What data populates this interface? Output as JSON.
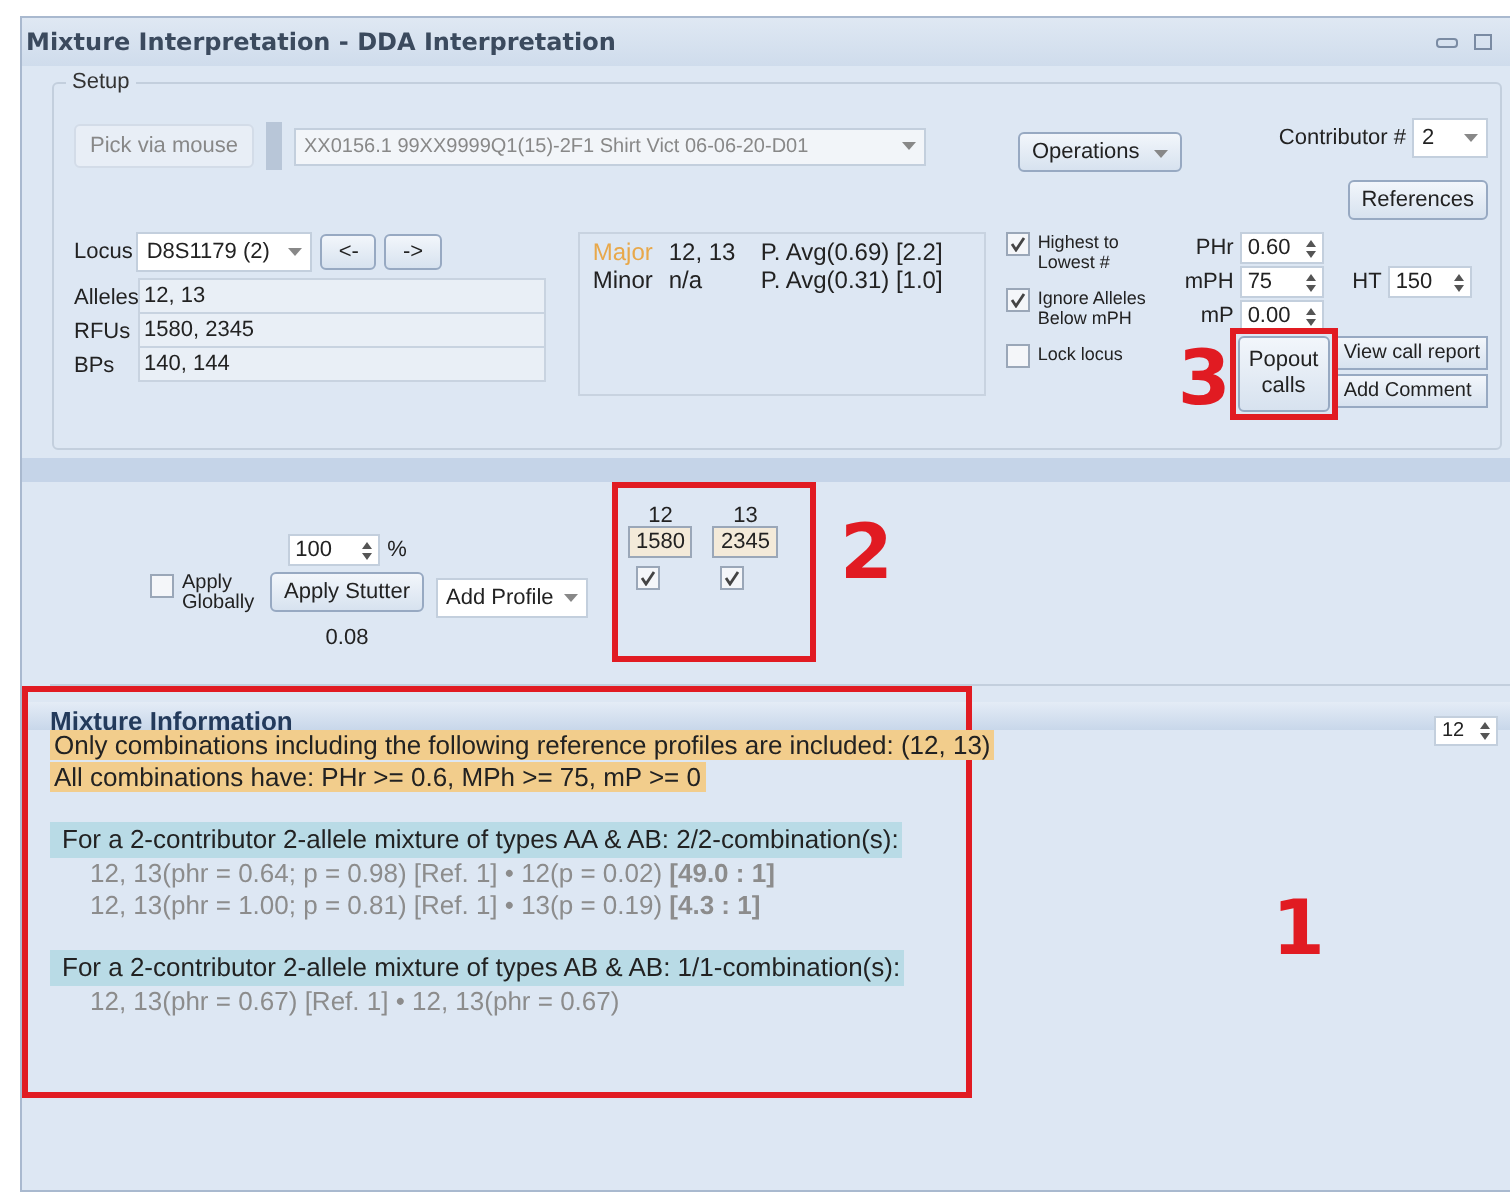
{
  "window": {
    "title": "Mixture Interpretation - DDA Interpretation"
  },
  "setup": {
    "label": "Setup",
    "pick_button": "Pick via mouse",
    "sample": "XX0156.1 99XX9999Q1(15)-2F1 Shirt Vict  06-06-20-D01",
    "operations_button": "Operations",
    "contributor": {
      "label": "Contributor #",
      "value": "2"
    },
    "references_button": "References",
    "locus": {
      "label": "Locus",
      "value": "D8S1179 (2)"
    },
    "prev_button": "<-",
    "next_button": "->",
    "fields": [
      {
        "label": "Alleles",
        "value": "12, 13"
      },
      {
        "label": "RFUs",
        "value": "1580, 2345"
      },
      {
        "label": "BPs",
        "value": "140, 144"
      }
    ],
    "calls": [
      {
        "label": "Major",
        "value": "12, 13",
        "average": "P. Avg(0.69) [2.2]",
        "highlighted": true
      },
      {
        "label": "Minor",
        "value": "n/a",
        "average": "P. Avg(0.31) [1.0]",
        "highlighted": false
      }
    ],
    "checks": [
      {
        "label": "Highest to Lowest #",
        "checked": true
      },
      {
        "label": "Ignore Alleles Below mPH",
        "checked": true
      },
      {
        "label": "Lock locus",
        "checked": false
      }
    ],
    "params": [
      {
        "label": "PHr",
        "value": "0.60"
      },
      {
        "label": "mPH",
        "value": "75"
      },
      {
        "label": "mP",
        "value": "0.00"
      }
    ],
    "ht": {
      "label": "HT",
      "value": "150"
    },
    "popout_button": "Popout calls",
    "popout_annotation": "3",
    "view_report_button": "View call report",
    "add_comment_button": "Add Comment"
  },
  "stutter": {
    "apply_globally": {
      "label": "Apply Globally",
      "checked": false
    },
    "percent": "100",
    "unit": "%",
    "apply_button": "Apply Stutter",
    "value": "0.08",
    "add_profile": "Add Profile",
    "alleles": [
      {
        "allele": "12",
        "rfu": "1580",
        "checked": true
      },
      {
        "allele": "13",
        "rfu": "2345",
        "checked": true
      }
    ],
    "alleles_annotation": "2"
  },
  "mixture": {
    "title": "Mixture Information",
    "spinner": "12",
    "annotation": "1",
    "notes": [
      "Only combinations including the following reference profiles are included: (12, 13)",
      "All combinations have:  PHr >= 0.6, MPh >= 75, mP >= 0"
    ],
    "groups": [
      {
        "heading": "For a 2-contributor 2-allele mixture of types AA & AB: 2/2-combination(s):",
        "lines": [
          "12, 13(phr = 0.64; p = 0.98) [Ref. 1] • 12(p = 0.02)  **[49.0 : 1]**",
          "12, 13(phr = 1.00; p = 0.81) [Ref. 1] • 13(p = 0.19)  **[4.3 : 1]**"
        ]
      },
      {
        "heading": "For a 2-contributor 2-allele mixture of types AB & AB: 1/1-combination(s):",
        "lines": [
          "12, 13(phr = 0.67) [Ref. 1] • 12, 13(phr = 0.67)"
        ]
      }
    ]
  }
}
